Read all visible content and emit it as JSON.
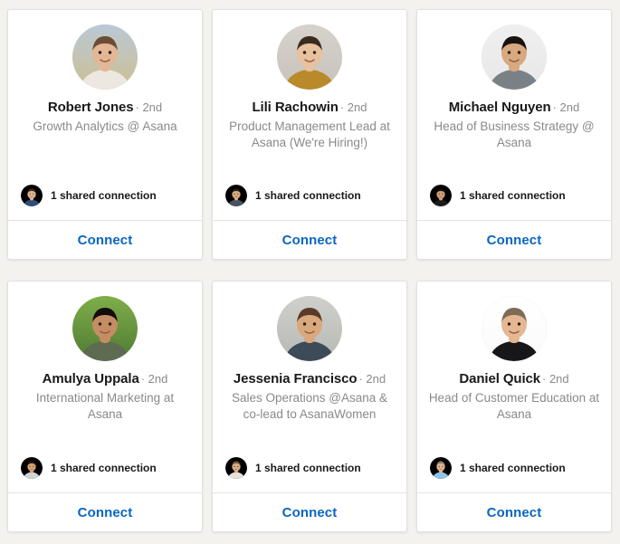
{
  "layout": {
    "background_color": "#f3f2ef",
    "card_background": "#ffffff",
    "card_border_color": "#e1e0dd",
    "accent_color": "#0a66c2",
    "name_color": "#191919",
    "muted_color": "#8a8a88",
    "columns": 3,
    "rows": 2
  },
  "cards": [
    {
      "name": "Robert Jones",
      "degree": "· 2nd",
      "headline": "Growth Analytics @ Asana",
      "shared_connection_text": "1 shared connection",
      "action_label": "Connect",
      "avatar_name": "robert-jones-avatar",
      "shared_avatar_name": "shared-connection-avatar",
      "avatar_colors": {
        "bg_top": "#b9c9d6",
        "bg_bottom": "#cdbf92",
        "skin": "#e3b696",
        "hair": "#6b4c35",
        "shirt": "#ece7e1"
      },
      "shared_colors": {
        "bg": "#6d7f8c",
        "skin": "#e0b395",
        "hair": "#3b3028",
        "shirt": "#2f4f7a"
      }
    },
    {
      "name": "Lili Rachowin",
      "degree": "· 2nd",
      "headline": "Product Management Lead at Asana (We're Hiring!)",
      "shared_connection_text": "1 shared connection",
      "action_label": "Connect",
      "avatar_name": "lili-rachowin-avatar",
      "shared_avatar_name": "shared-connection-avatar",
      "avatar_colors": {
        "bg_top": "#d6d2cc",
        "bg_bottom": "#c7c2bb",
        "skin": "#e8c19e",
        "hair": "#3a2a20",
        "shirt": "#b98a2a"
      },
      "shared_colors": {
        "bg": "#9fb4c6",
        "skin": "#d9a97f",
        "hair": "#2a211c",
        "shirt": "#45545f"
      }
    },
    {
      "name": "Michael Nguyen",
      "degree": "· 2nd",
      "headline": "Head of Business Strategy @ Asana",
      "shared_connection_text": "1 shared connection",
      "action_label": "Connect",
      "avatar_name": "michael-nguyen-avatar",
      "shared_avatar_name": "shared-connection-avatar",
      "avatar_colors": {
        "bg_top": "#efefef",
        "bg_bottom": "#e8e8e8",
        "skin": "#d8a87e",
        "hair": "#18130f",
        "shirt": "#7a8186"
      },
      "shared_colors": {
        "bg": "#4a4138",
        "skin": "#cfa075",
        "hair": "#14100c",
        "shirt": "#1b1b1b"
      }
    },
    {
      "name": "Amulya Uppala",
      "degree": "· 2nd",
      "headline": "International Marketing at Asana",
      "shared_connection_text": "1 shared connection",
      "action_label": "Connect",
      "avatar_name": "amulya-uppala-avatar",
      "shared_avatar_name": "shared-connection-avatar",
      "avatar_colors": {
        "bg_top": "#7fae4a",
        "bg_bottom": "#4f7a33",
        "skin": "#c58d63",
        "hair": "#120d0a",
        "shirt": "#5d6b52"
      },
      "shared_colors": {
        "bg": "#e05a3a",
        "skin": "#d8a274",
        "hair": "#241a14",
        "shirt": "#cfd4d8"
      }
    },
    {
      "name": "Jessenia Francisco",
      "degree": "· 2nd",
      "headline": "Sales Operations @Asana & co-lead to AsanaWomen",
      "shared_connection_text": "1 shared connection",
      "action_label": "Connect",
      "avatar_name": "jessenia-francisco-avatar",
      "shared_avatar_name": "shared-connection-avatar",
      "avatar_colors": {
        "bg_top": "#cfd0cb",
        "bg_bottom": "#b7b9b4",
        "skin": "#d9a87c",
        "hair": "#5a3a27",
        "shirt": "#3d4a57"
      },
      "shared_colors": {
        "bg": "#cfc6bd",
        "skin": "#d9ad85",
        "hair": "#7a5433",
        "shirt": "#e6e1da"
      }
    },
    {
      "name": "Daniel Quick",
      "degree": "· 2nd",
      "headline": "Head of Customer Education at Asana",
      "shared_connection_text": "1 shared connection",
      "action_label": "Connect",
      "avatar_name": "daniel-quick-avatar",
      "shared_avatar_name": "shared-connection-avatar",
      "avatar_colors": {
        "bg_top": "#ffffff",
        "bg_bottom": "#fafafa",
        "skin": "#e5b893",
        "hair": "#7d6b55",
        "shirt": "#17171a"
      },
      "shared_colors": {
        "bg": "#8f6fb0",
        "skin": "#e0b58f",
        "hair": "#8a7a62",
        "shirt": "#8fc4e8"
      }
    }
  ]
}
